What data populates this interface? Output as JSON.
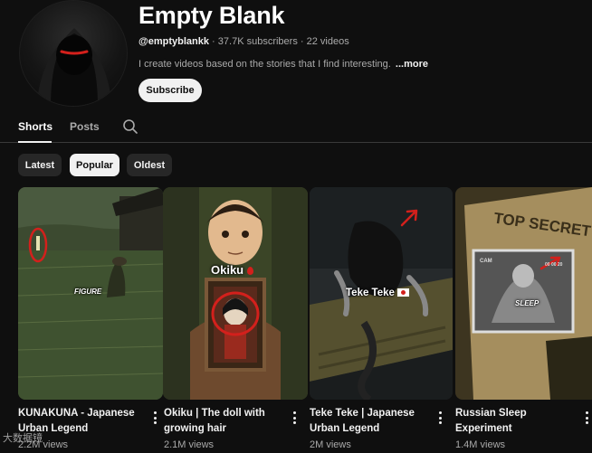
{
  "channel": {
    "name": "Empty Blank",
    "handle": "@emptyblankk",
    "subscribers": "37.7K subscribers",
    "videos": "22 videos",
    "separator": "·",
    "description": "I create videos based on the stories that I find interesting.",
    "more_label": "...more",
    "subscribe_label": "Subscribe"
  },
  "tabs": [
    {
      "label": "Shorts",
      "active": true
    },
    {
      "label": "Posts",
      "active": false
    }
  ],
  "filters": [
    {
      "label": "Latest",
      "active": false
    },
    {
      "label": "Popular",
      "active": true
    },
    {
      "label": "Oldest",
      "active": false
    }
  ],
  "shorts": [
    {
      "title": "KUNAKUNA - Japanese Urban Legend",
      "views": "2.2M views",
      "overlay": "FIGURE"
    },
    {
      "title": "Okiku | The doll with growing hair",
      "views": "2.1M views",
      "overlay": "Okiku"
    },
    {
      "title": "Teke Teke | Japanese Urban Legend",
      "views": "2M views",
      "overlay": "Teke Teke"
    },
    {
      "title": "Russian Sleep Experiment",
      "views": "1.4M views",
      "overlay": "TOP SECRET",
      "overlay2": "SLEEP",
      "cam_label": "CAM",
      "cam_time": "00 00 20"
    }
  ],
  "watermark": "大数据镜",
  "colors": {
    "background": "#0f0f0f",
    "accent_red": "#d3201c",
    "chip_bg": "#272727",
    "text_secondary": "#aaaaaa"
  },
  "icons": [
    "avatar-hooded-figure",
    "search-icon",
    "more-vert-icon",
    "blood-drop-icon",
    "japan-flag-icon"
  ]
}
